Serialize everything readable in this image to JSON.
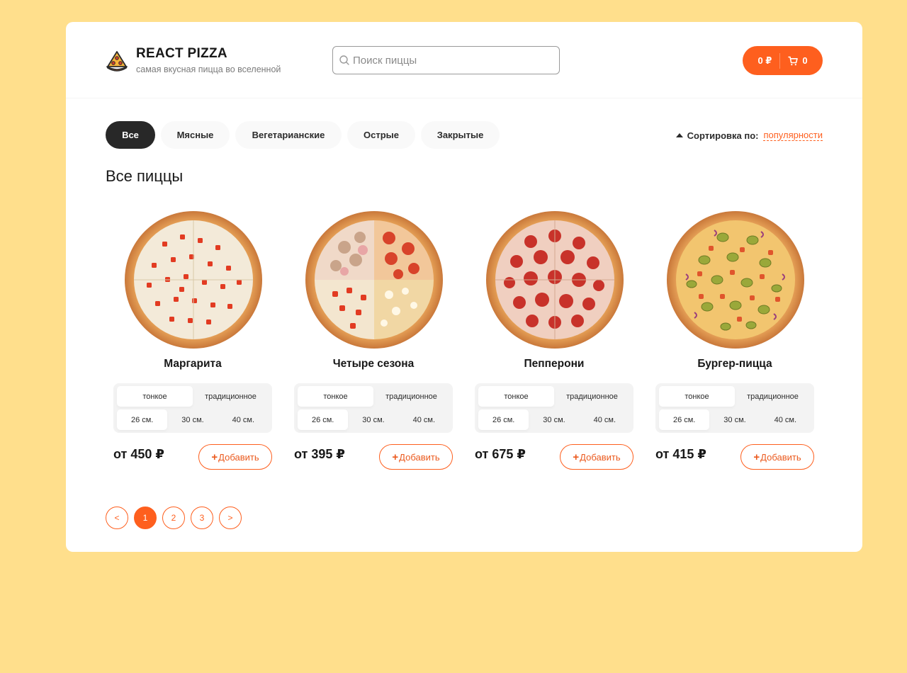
{
  "colors": {
    "accent": "#fe5f1e",
    "background": "#ffdf8c",
    "dark": "#282828"
  },
  "header": {
    "logo_title": "REACT PIZZA",
    "logo_subtitle": "самая вкусная пицца во вселенной",
    "logo_icon": "pizza-slice-icon",
    "search": {
      "placeholder": "Поиск пиццы",
      "value": "",
      "icon": "search-icon"
    },
    "cart": {
      "price": "0 ₽",
      "count": "0",
      "icon": "cart-icon"
    }
  },
  "categories": [
    {
      "label": "Все",
      "active": true
    },
    {
      "label": "Мясные",
      "active": false
    },
    {
      "label": "Вегетарианские",
      "active": false
    },
    {
      "label": "Острые",
      "active": false
    },
    {
      "label": "Закрытые",
      "active": false
    }
  ],
  "sort": {
    "label": "Сортировка по:",
    "value": "популярности",
    "icon": "caret-up-icon"
  },
  "content_title": "Все пиццы",
  "pizzas": [
    {
      "title": "Маргарита",
      "types": [
        {
          "label": "тонкое",
          "active": true
        },
        {
          "label": "традиционное",
          "active": false
        }
      ],
      "sizes": [
        {
          "label": "26 см.",
          "active": true
        },
        {
          "label": "30 см.",
          "active": false
        },
        {
          "label": "40 см.",
          "active": false
        }
      ],
      "price": "от 450 ₽",
      "add_label": "Добавить"
    },
    {
      "title": "Четыре сезона",
      "types": [
        {
          "label": "тонкое",
          "active": true
        },
        {
          "label": "традиционное",
          "active": false
        }
      ],
      "sizes": [
        {
          "label": "26 см.",
          "active": true
        },
        {
          "label": "30 см.",
          "active": false
        },
        {
          "label": "40 см.",
          "active": false
        }
      ],
      "price": "от 395 ₽",
      "add_label": "Добавить"
    },
    {
      "title": "Пепперони",
      "types": [
        {
          "label": "тонкое",
          "active": true
        },
        {
          "label": "традиционное",
          "active": false
        }
      ],
      "sizes": [
        {
          "label": "26 см.",
          "active": true
        },
        {
          "label": "30 см.",
          "active": false
        },
        {
          "label": "40 см.",
          "active": false
        }
      ],
      "price": "от 675 ₽",
      "add_label": "Добавить"
    },
    {
      "title": "Бургер-пицца",
      "types": [
        {
          "label": "тонкое",
          "active": true
        },
        {
          "label": "традиционное",
          "active": false
        }
      ],
      "sizes": [
        {
          "label": "26 см.",
          "active": true
        },
        {
          "label": "30 см.",
          "active": false
        },
        {
          "label": "40 см.",
          "active": false
        }
      ],
      "price": "от 415 ₽",
      "add_label": "Добавить"
    }
  ],
  "pagination": {
    "prev": "<",
    "pages": [
      {
        "label": "1",
        "active": true
      },
      {
        "label": "2",
        "active": false
      },
      {
        "label": "3",
        "active": false
      }
    ],
    "next": ">"
  }
}
